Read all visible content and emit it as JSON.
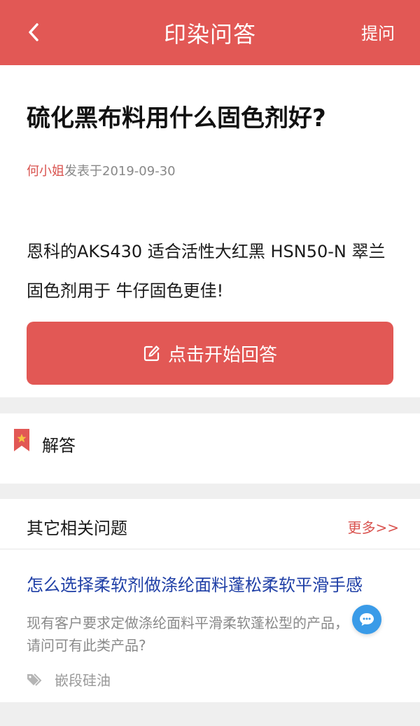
{
  "header": {
    "title": "印染问答",
    "ask_label": "提问"
  },
  "question": {
    "title": "硫化黑布料用什么固色剂好?",
    "author": "何小姐",
    "posted_text": "发表于2019-09-30",
    "body": "恩科的AKS430 适合活性大红黑 HSN50-N 翠兰固色剂用于 牛仔固色更佳!",
    "start_answer_label": "点击开始回答"
  },
  "answers": {
    "label": "解答"
  },
  "related": {
    "title": "其它相关问题",
    "more_label": "更多>>",
    "items": [
      {
        "title": "怎么选择柔软剂做涤纶面料蓬松柔软平滑手感",
        "desc": "现有客户要求定做涤纶面料平滑柔软蓬松型的产品，请问可有此类产品?",
        "tag": "嵌段硅油"
      }
    ]
  },
  "colors": {
    "brand_red": "#e25855",
    "link_blue": "#1f3fa6",
    "chat_blue": "#3a9be8"
  },
  "icons": {
    "back": "chevron-left-icon",
    "edit": "edit-icon",
    "bookmark": "bookmark-icon",
    "tag": "tag-icon",
    "chat": "chat-bubble-icon"
  }
}
